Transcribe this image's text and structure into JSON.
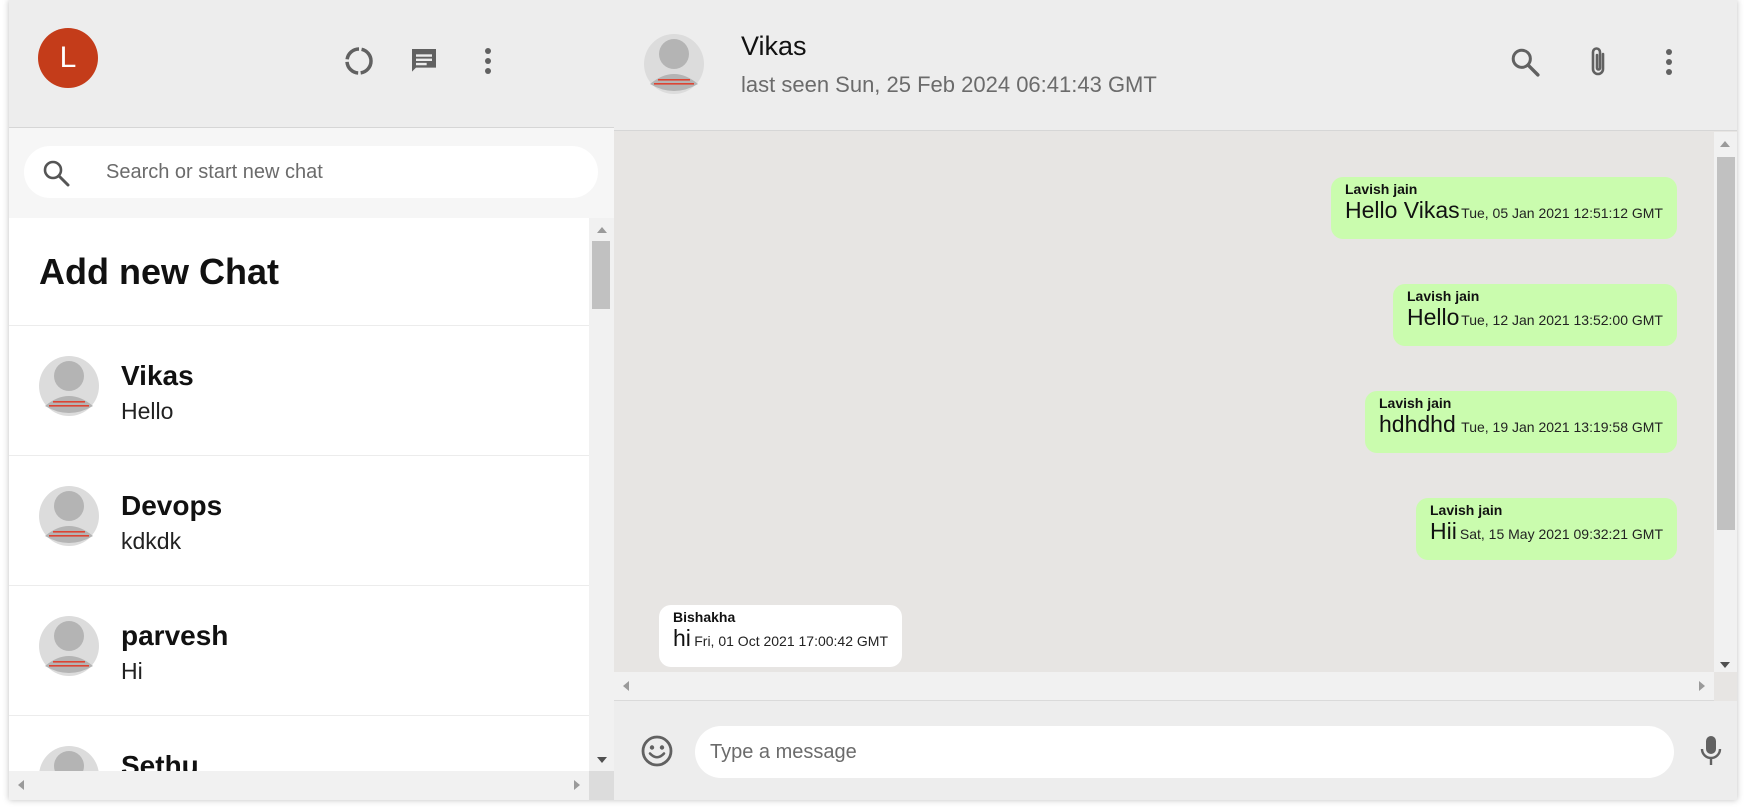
{
  "sidebar": {
    "user_avatar_letter": "L",
    "search_placeholder": "Search or start new chat",
    "add_new_chat": "Add new Chat",
    "chats": [
      {
        "name": "Vikas",
        "last_message": "Hello"
      },
      {
        "name": "Devops",
        "last_message": "kdkdk"
      },
      {
        "name": "parvesh",
        "last_message": "Hi"
      },
      {
        "name": "Sethu",
        "last_message": ""
      }
    ]
  },
  "header": {
    "contact_name": "Vikas",
    "last_seen": "last seen Sun, 25 Feb 2024 06:41:43 GMT"
  },
  "messages": [
    {
      "author": "Lavish jain",
      "text": "Hello Vikas",
      "time": "Tue, 05 Jan 2021 12:51:12 GMT",
      "sent": true
    },
    {
      "author": "Lavish jain",
      "text": "Hello",
      "time": "Tue, 12 Jan 2021 13:52:00 GMT",
      "sent": true
    },
    {
      "author": "Lavish jain",
      "text": "hdhdhd",
      "time": "Tue, 19 Jan 2021 13:19:58 GMT",
      "sent": true
    },
    {
      "author": "Lavish jain",
      "text": "Hii",
      "time": "Sat, 15 May 2021 09:32:21 GMT",
      "sent": true
    },
    {
      "author": "Bishakha",
      "text": "hi",
      "time": "Fri, 01 Oct 2021 17:00:42 GMT",
      "sent": false
    }
  ],
  "footer": {
    "message_placeholder": "Type a message"
  },
  "colors": {
    "user_avatar": "#c43c1a",
    "sent_bubble": "#cafcae",
    "received_bubble": "#ffffff",
    "chat_background": "#e7e5e3"
  },
  "icons": {
    "status": "status-icon",
    "new_chat": "message-icon",
    "menu": "more-vertical-icon",
    "search": "search-icon",
    "attach": "paperclip-icon",
    "emoji": "emoji-icon",
    "mic": "microphone-icon"
  }
}
